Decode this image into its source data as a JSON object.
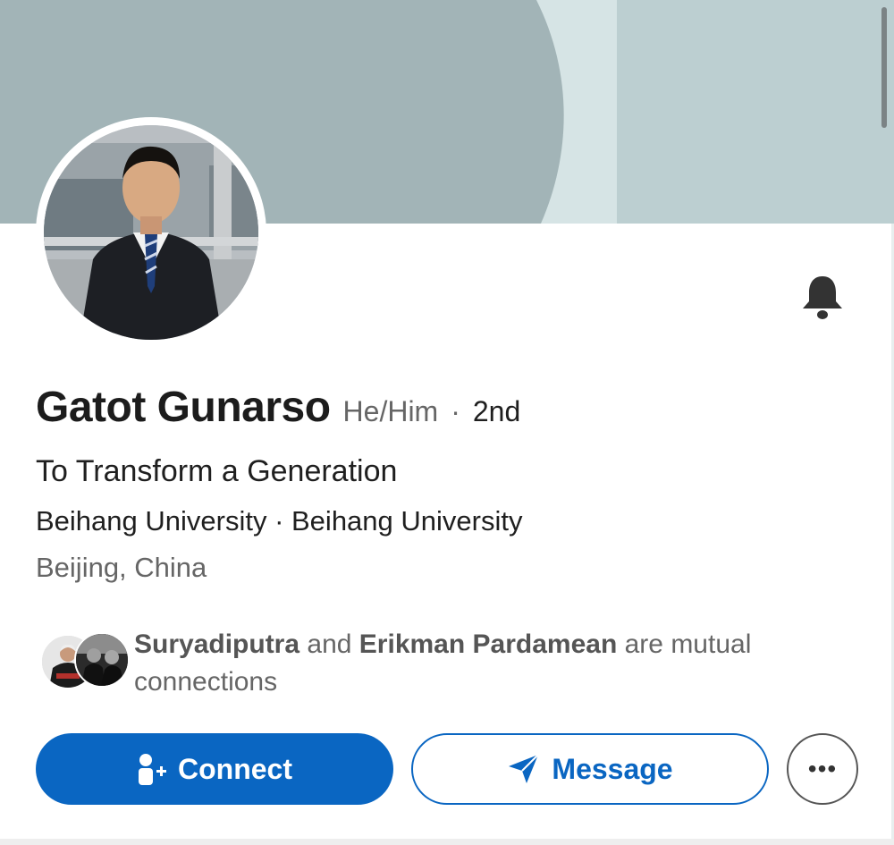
{
  "colors": {
    "accent": "#0a66c2",
    "banner_dark": "#a2b4b7",
    "banner_light": "#bccfd1",
    "muted_text": "#666666"
  },
  "profile": {
    "name": "Gatot Gunarso",
    "pronouns": "He/Him",
    "separator": "·",
    "degree": "2nd",
    "headline": "To Transform a Generation",
    "organization": "Beihang University · Beihang University",
    "location": "Beijing, China"
  },
  "mutual": {
    "person1": "Suryadiputra",
    "connector": "and",
    "person2": "Erikman Pardamean",
    "suffix": "are mutual connections"
  },
  "actions": {
    "connect_label": "Connect",
    "message_label": "Message",
    "more_label": "•••"
  },
  "icons": {
    "notify": "bell-icon",
    "connect": "add-person-icon",
    "message": "send-icon",
    "more": "more-icon"
  }
}
